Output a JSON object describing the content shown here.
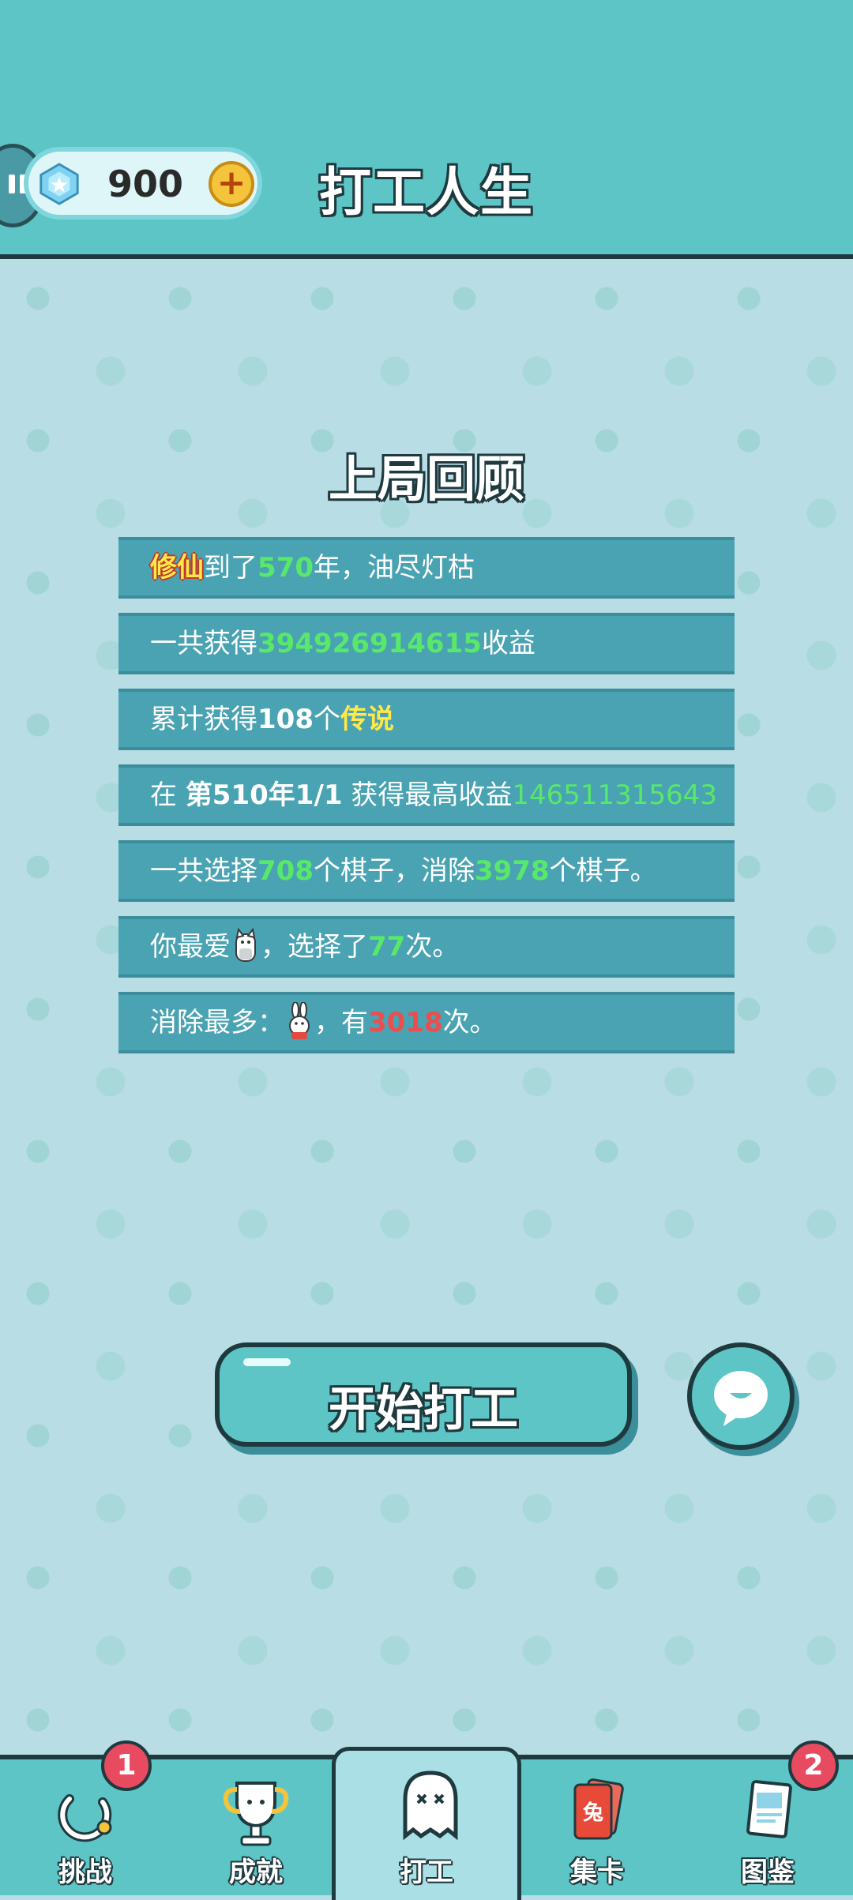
{
  "header": {
    "title": "打工人生",
    "currency": {
      "icon": "diamond-gem-icon",
      "value": "900",
      "add_icon": "plus-icon"
    },
    "pause_icon": "pause-icon"
  },
  "recap": {
    "title": "上局回顾",
    "rows": [
      {
        "parts": [
          "修仙",
          "到了",
          "570",
          "年，油尽灯枯"
        ]
      },
      {
        "parts": [
          "一共获得",
          "394926914615",
          "收益"
        ]
      },
      {
        "parts": [
          "累计获得",
          "108",
          "个",
          "传说"
        ]
      },
      {
        "parts": [
          "在 ",
          "第510年1/1",
          " 获得最高收益",
          "146511315643"
        ]
      },
      {
        "parts": [
          "一共选择",
          "708",
          "个棋子，消除",
          "3978",
          "个棋子。"
        ]
      },
      {
        "parts": [
          "你最爱",
          "，选择了",
          "77",
          "次。"
        ],
        "icon": "cat-icon"
      },
      {
        "parts": [
          "消除最多：",
          "，有",
          "3018",
          "次。"
        ],
        "icon": "rabbit-icon"
      }
    ]
  },
  "actions": {
    "start_label": "开始打工",
    "chat_icon": "chat-bubble-icon"
  },
  "nav": {
    "items": [
      {
        "label": "挑战",
        "icon": "challenge-ring-icon",
        "badge": "1"
      },
      {
        "label": "成就",
        "icon": "trophy-icon"
      },
      {
        "label": "打工",
        "icon": "ghost-icon",
        "active": true
      },
      {
        "label": "集卡",
        "icon": "card-icon",
        "card_text": "兔"
      },
      {
        "label": "图鉴",
        "icon": "book-icon",
        "badge": "2"
      }
    ]
  },
  "colors": {
    "teal": "#5ec5c6",
    "background": "#b9dde5",
    "row": "#4aa3b2",
    "highlight_green": "#58e86a",
    "highlight_yellow": "#ffe84a",
    "highlight_red": "#ee4d4d",
    "outline": "#1f3a3f"
  }
}
